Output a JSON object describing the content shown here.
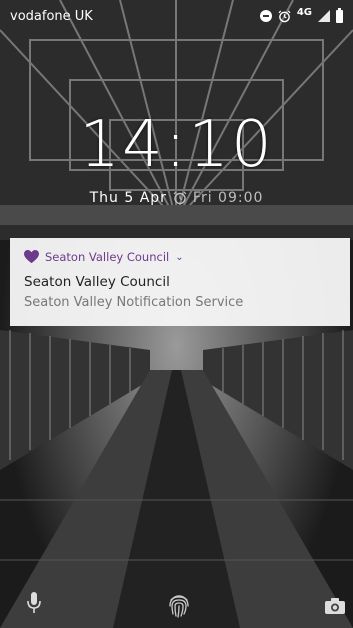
{
  "status_bar": {
    "carrier": "vodafone UK",
    "network": "4G"
  },
  "lock_screen": {
    "time": "14:10",
    "date": "Thu 5 Apr",
    "next_alarm": "Fri 09:00"
  },
  "notification": {
    "app_name": "Seaton Valley Council",
    "title": "Seaton Valley Council",
    "text": "Seaton Valley Notification Service",
    "accent_color": "#6d3b8c"
  },
  "icons": {
    "status": [
      "do-not-disturb-icon",
      "alarm-icon",
      "signal-icon",
      "battery-icon"
    ],
    "bottom": [
      "mic-icon",
      "fingerprint-icon",
      "camera-icon"
    ]
  }
}
